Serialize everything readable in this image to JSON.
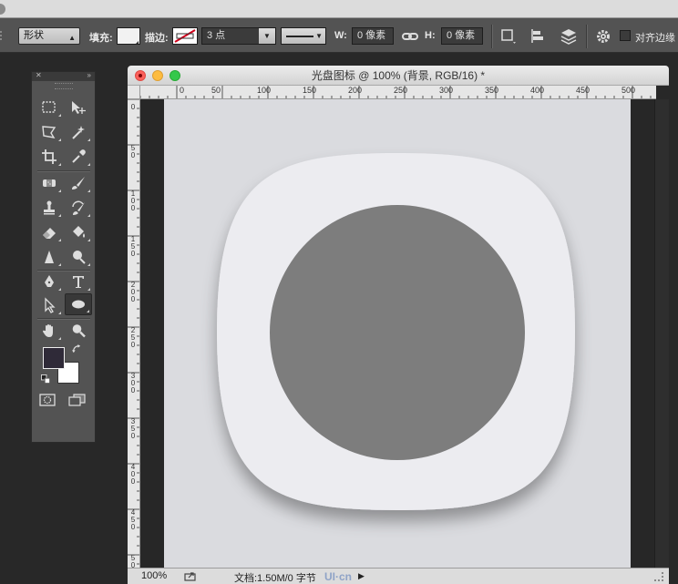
{
  "options_bar": {
    "mode_select": "形状",
    "fill_label": "填充:",
    "stroke_label": "描边:",
    "stroke_width": "3 点",
    "w_label": "W:",
    "w_value": "0 像素",
    "h_label": "H:",
    "h_value": "0 像素",
    "align_edges_label": "对齐边缘"
  },
  "tools": {
    "items": [
      "rect-marquee-tool",
      "move-tool",
      "polygon-lasso-tool",
      "magic-wand-tool",
      "crop-tool",
      "eyedropper-tool",
      "healing-brush-tool",
      "brush-tool",
      "clone-stamp-tool",
      "history-brush-tool",
      "eraser-tool",
      "paint-bucket-tool",
      "sharpen-tool",
      "dodge-tool",
      "pen-tool",
      "type-tool",
      "path-select-tool",
      "ellipse-tool",
      "hand-tool",
      "zoom-tool"
    ],
    "active_tool": "ellipse-tool",
    "foreground_color": "#2f2a38",
    "background_color": "#ffffff"
  },
  "document": {
    "title": "光盘图标 @ 100% (背景, RGB/16) *",
    "ruler_h_labels": [
      "0",
      "50",
      "100",
      "150",
      "200",
      "250",
      "300",
      "350",
      "400",
      "450",
      "500"
    ],
    "ruler_v_labels": [
      "0",
      "50",
      "100",
      "150",
      "200",
      "250",
      "300",
      "350",
      "400",
      "450",
      "500"
    ],
    "zoom": "100%",
    "doc_info": "文档:1.50M/0 字节",
    "canvas_color": "#dadbdf",
    "icon_body_color": "#ececf0",
    "disc_color": "#7d7d7d"
  },
  "watermark": "UI·cn"
}
